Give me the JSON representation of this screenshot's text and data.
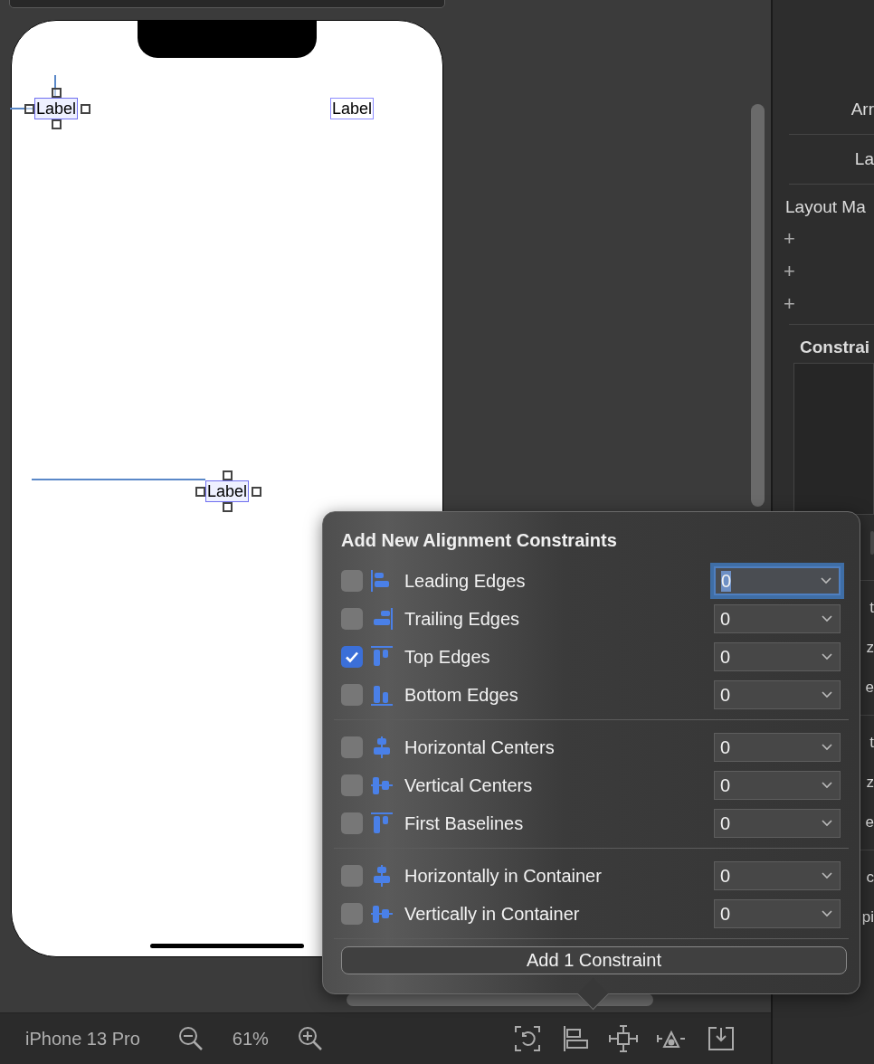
{
  "canvas": {
    "labels": [
      {
        "text": "Label",
        "selected": true
      },
      {
        "text": "Label",
        "selected": false
      },
      {
        "text": "Label",
        "selected": true
      }
    ]
  },
  "popover": {
    "title": "Add New Alignment Constraints",
    "sections": [
      {
        "rows": [
          {
            "kind": "leading",
            "label": "Leading Edges",
            "checked": false,
            "value": "0",
            "focused": true
          },
          {
            "kind": "trailing",
            "label": "Trailing Edges",
            "checked": false,
            "value": "0",
            "focused": false
          },
          {
            "kind": "top",
            "label": "Top Edges",
            "checked": true,
            "value": "0",
            "focused": false
          },
          {
            "kind": "bottom",
            "label": "Bottom Edges",
            "checked": false,
            "value": "0",
            "focused": false
          }
        ]
      },
      {
        "rows": [
          {
            "kind": "hcenter",
            "label": "Horizontal Centers",
            "checked": false,
            "value": "0",
            "focused": false
          },
          {
            "kind": "vcenter",
            "label": "Vertical Centers",
            "checked": false,
            "value": "0",
            "focused": false
          },
          {
            "kind": "baseline",
            "label": "First Baselines",
            "checked": false,
            "value": "0",
            "focused": false
          }
        ]
      },
      {
        "rows": [
          {
            "kind": "hcenter",
            "label": "Horizontally in Container",
            "checked": false,
            "value": "0",
            "focused": false
          },
          {
            "kind": "vcenter",
            "label": "Vertically in Container",
            "checked": false,
            "value": "0",
            "focused": false
          }
        ]
      }
    ],
    "button": "Add 1 Constraint"
  },
  "inspector": {
    "rows": [
      "Arr",
      "La"
    ],
    "section": "Layout Ma",
    "add_buttons": [
      "+",
      "+",
      "+"
    ],
    "constraints_title": "Constrai",
    "cut_rows": [
      [
        "t",
        "z",
        "e"
      ],
      [
        "t",
        "z",
        "e"
      ],
      [
        "c",
        "pi"
      ]
    ]
  },
  "bottom_bar": {
    "device": "iPhone 13 Pro",
    "zoom": "61%"
  }
}
